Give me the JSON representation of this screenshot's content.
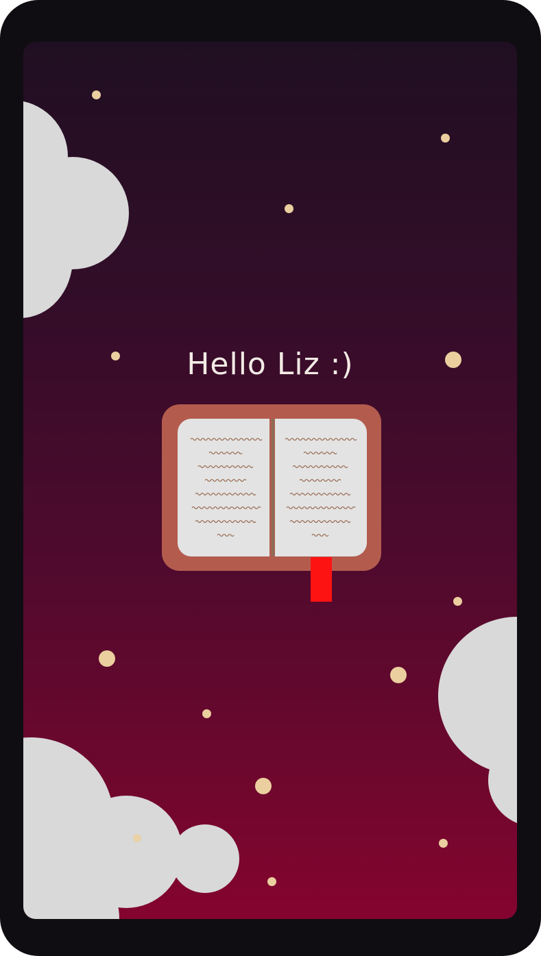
{
  "greeting": {
    "text": "Hello Liz :)"
  },
  "colors": {
    "frame": "#100d12",
    "gradient_top": "#200f22",
    "gradient_bottom": "#84042f",
    "cloud": "#d9d9d9",
    "star": "#ebcf9f",
    "book_cover": "#b35c4e",
    "book_page": "#e3e3e3",
    "bookmark": "#fe1313",
    "text": "#f3ebe5"
  },
  "icons": {
    "book": "open-book-icon",
    "bookmark": "bookmark-ribbon"
  }
}
